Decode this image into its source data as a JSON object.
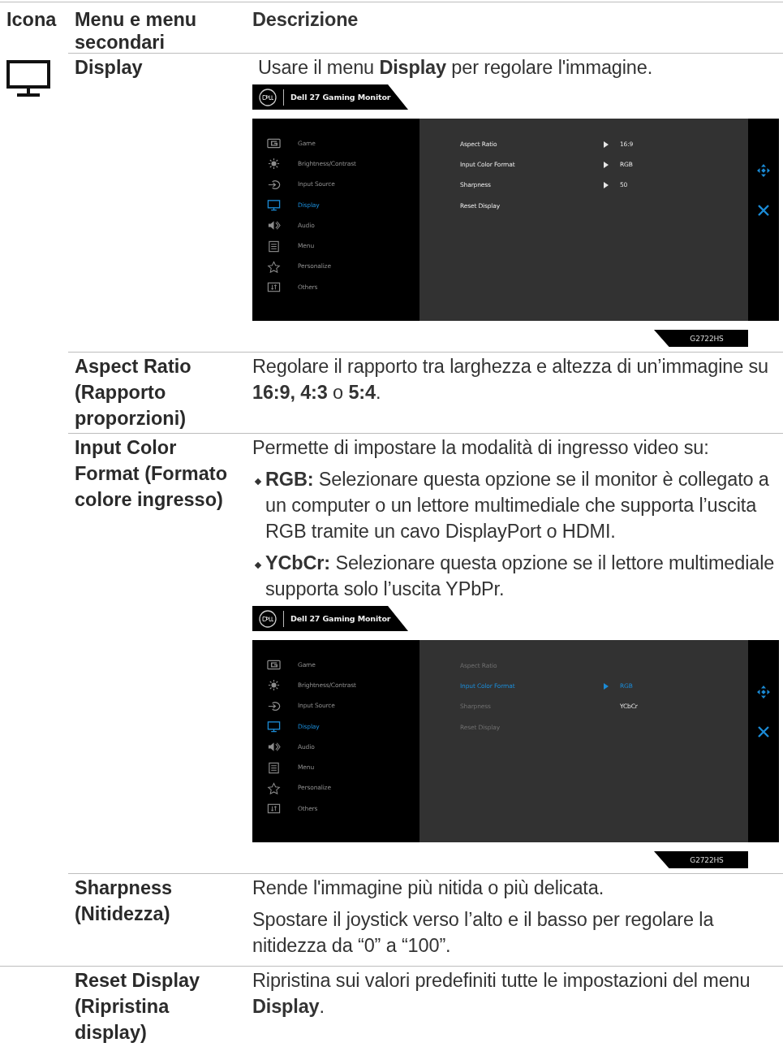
{
  "table": {
    "columns": [
      "Icona",
      "Menu e menu secondari",
      "Descrizione"
    ],
    "rows": [
      {
        "menu": "Display",
        "description": [
          {
            "kind": "text",
            "text": "Usare il menu **Display** per regolare l'immagine."
          },
          {
            "kind": "osd",
            "title": "Dell 27 Gaming Monitor",
            "model": "G2722HS",
            "menu": [
              {
                "label": "Game",
                "selected": false
              },
              {
                "label": "Brightness/Contrast",
                "selected": false
              },
              {
                "label": "Input Source",
                "selected": false
              },
              {
                "label": "Display",
                "selected": true
              },
              {
                "label": "Audio",
                "selected": false
              },
              {
                "label": "Menu",
                "selected": false
              },
              {
                "label": "Personalize",
                "selected": false
              },
              {
                "label": "Others",
                "selected": false
              }
            ],
            "settings": [
              {
                "label": "Aspect Ratio",
                "selected": false,
                "disabled": false,
                "arrow": true,
                "value": "16:9",
                "value_selected": false
              },
              {
                "label": "Input Color Format",
                "selected": false,
                "disabled": false,
                "arrow": true,
                "value": "RGB",
                "value_selected": false
              },
              {
                "label": "Sharpness",
                "selected": false,
                "disabled": false,
                "arrow": true,
                "value": "50",
                "value_selected": false
              },
              {
                "label": "Reset Display",
                "selected": false,
                "disabled": false,
                "arrow": false
              }
            ]
          }
        ]
      },
      {
        "menu": "Aspect Ratio (Rapporto proporzioni)",
        "description": [
          {
            "kind": "text",
            "text": "Regolare il rapporto tra larghezza e altezza di un’immagine su **16:9, 4:3** o **5:4**."
          }
        ]
      },
      {
        "menu": "Input Color Format (Formato colore ingresso)",
        "description": [
          {
            "kind": "text",
            "text": "Permette di impostare la modalità di ingresso video su:"
          },
          {
            "kind": "bullet",
            "text": "**RGB:** Selezionare questa opzione se il monitor è collegato a un computer o un lettore multimediale che supporta l’uscita RGB tramite un cavo DisplayPort o HDMI."
          },
          {
            "kind": "bullet",
            "text": "**YCbCr:** Selezionare questa opzione se il lettore multimediale supporta solo l’uscita YPbPr."
          },
          {
            "kind": "osd",
            "title": "Dell 27 Gaming Monitor",
            "model": "G2722HS",
            "menu": [
              {
                "label": "Game",
                "selected": false
              },
              {
                "label": "Brightness/Contrast",
                "selected": false
              },
              {
                "label": "Input Source",
                "selected": false
              },
              {
                "label": "Display",
                "selected": true
              },
              {
                "label": "Audio",
                "selected": false
              },
              {
                "label": "Menu",
                "selected": false
              },
              {
                "label": "Personalize",
                "selected": false
              },
              {
                "label": "Others",
                "selected": false
              }
            ],
            "settings": [
              {
                "label": "Aspect Ratio",
                "selected": false,
                "disabled": true,
                "arrow": false
              },
              {
                "label": "Input Color Format",
                "selected": true,
                "disabled": false,
                "arrow": true,
                "value": "RGB",
                "value_selected": true
              },
              {
                "label": "Sharpness",
                "selected": false,
                "disabled": true,
                "arrow": false,
                "value": "YCbCr",
                "value_selected": false
              },
              {
                "label": "Reset Display",
                "selected": false,
                "disabled": true,
                "arrow": false
              }
            ]
          }
        ]
      },
      {
        "menu": "Sharpness (Nitidezza)",
        "description": [
          {
            "kind": "text",
            "text": "Rende l'immagine più nitida o più delicata."
          },
          {
            "kind": "text",
            "text": "Spostare il joystick verso l’alto e il basso per regolare la nitidezza da “0” a “100”."
          }
        ]
      },
      {
        "menu": "Reset Display (Ripristina display)",
        "description": [
          {
            "kind": "text",
            "text": "Ripristina sui valori predefiniti tutte le impostazioni del menu **Display**."
          }
        ]
      }
    ]
  }
}
